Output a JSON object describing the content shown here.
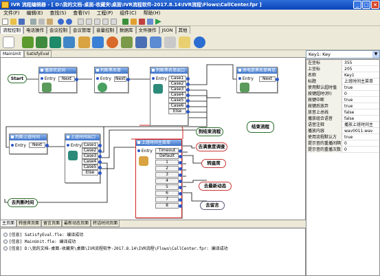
{
  "window": {
    "title": "IVR 流程编辑器 - [ D:\\我的文档-桌面-收藏夹\\桌面\\IVR流程软件-2017.8.14\\IVR流程\\Flows\\CallCenter.fpr ]"
  },
  "menu": [
    "文件(F)",
    "编辑(E)",
    "查找(S)",
    "查看(V)",
    "工程(P)",
    "组件(C)",
    "帮助(H)"
  ],
  "tabs": [
    "流程控制",
    "电话操作",
    "会议控制",
    "会议管理",
    "音量控制",
    "数据库",
    "文件操作",
    "JSON",
    "其他"
  ],
  "doc_tabs": [
    "MainUnit",
    "SatisfyEval"
  ],
  "flow": {
    "start": "Start",
    "entry": "Entry",
    "next": "Next",
    "else": "Else",
    "timeout": "Timeout",
    "default": "Default",
    "n1": "播放欢迎词",
    "n2": "判断黑名单",
    "n3": "判断黑名单出口",
    "n4": "来电是黑名单再见",
    "n5": "判断上班时间",
    "n6": "上班时间出口",
    "n7": "上班时间主菜单",
    "cases": [
      "Case1",
      "Case2",
      "Case3",
      "Case4",
      "Case5",
      "Case6"
    ],
    "menu_ports": [
      "1",
      "2",
      "3",
      "4",
      "5",
      "6",
      "7",
      "8"
    ],
    "p_goto": "到结束流程",
    "p_end": "结束流程",
    "p_sat": "去满意度调查",
    "p_seat": "转座席",
    "p_news": "去最新动态",
    "p_msg": "去留言",
    "p_off": "去判断时间"
  },
  "bottom_tabs": [
    "主页面",
    "转座席页面",
    "留言页面",
    "最新动态页面",
    "转话时间页面"
  ],
  "log": [
    "[信息] SatisfyEval.fle: 编译成功",
    "[信息] MainUnit.fle: 编译成功",
    "[信息] D:\\我的文档-桌面-收藏夹\\桌面\\IVR流程软件-2017.8.14\\IVR流程\\Flows\\CallCenter.fpr: 编译成功"
  ],
  "props_header": "Key1: Key",
  "props": [
    [
      "左坐标",
      "355"
    ],
    [
      "上坐标",
      "205"
    ],
    [
      "名称",
      "Key1"
    ],
    [
      "标题",
      "上班时间主菜单"
    ],
    [
      "使用默认超时值",
      "true"
    ],
    [
      "按键超时(秒)",
      "0"
    ],
    [
      "按键中断",
      "true"
    ],
    [
      "按键后放弃",
      "true"
    ],
    [
      "放音上总线",
      "false"
    ],
    [
      "播放组合语音",
      "false"
    ],
    [
      "语音注释",
      "播放上班时间主"
    ],
    [
      "播放内容",
      "wav0011.wav"
    ],
    [
      "使用流程默认方",
      "true"
    ],
    [
      "提示音的重播间隔",
      "0"
    ],
    [
      "提示音的重播次数",
      "0"
    ]
  ]
}
